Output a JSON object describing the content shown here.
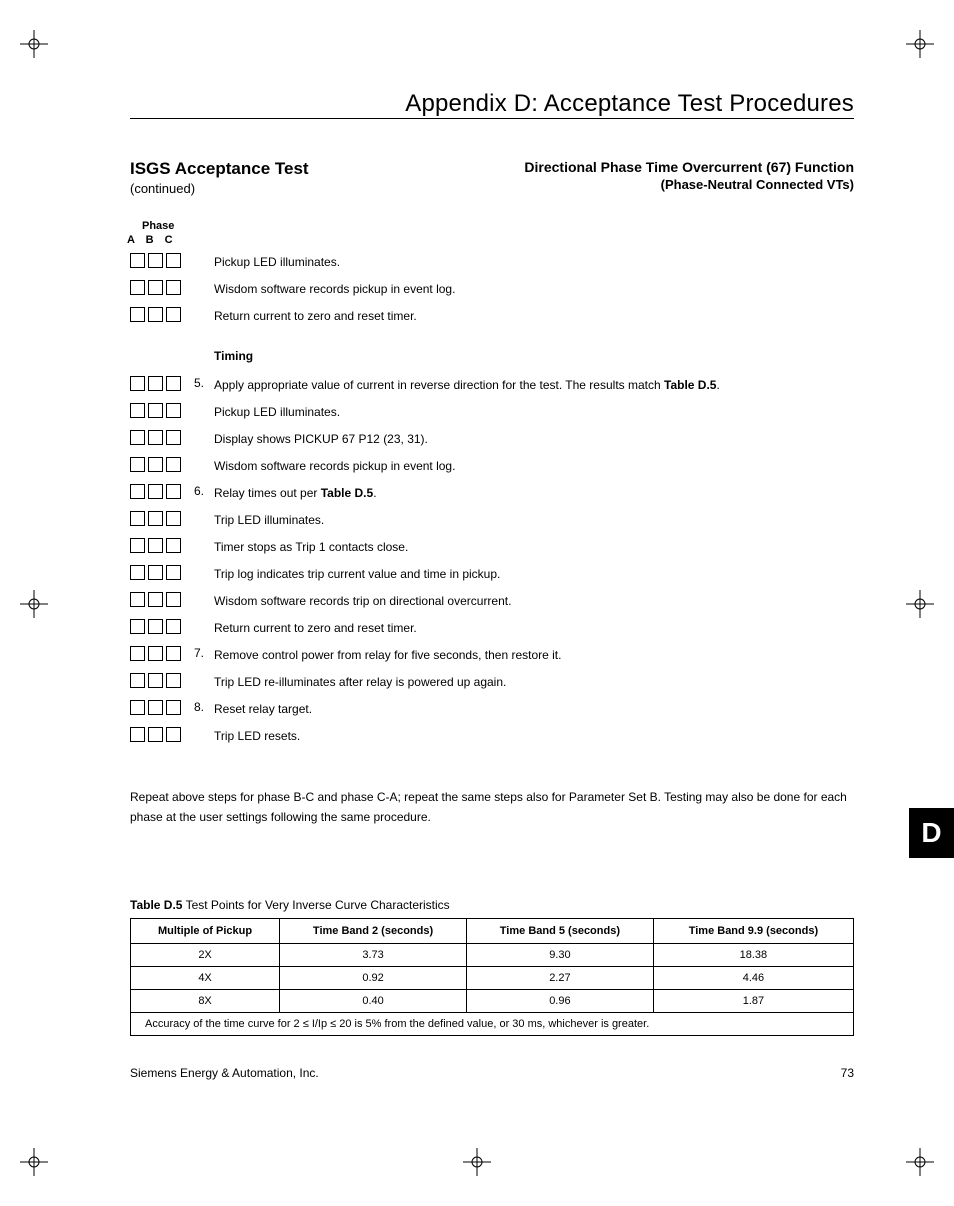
{
  "appendix_title": "Appendix D:  Acceptance Test Procedures",
  "header": {
    "left_title": "ISGS Acceptance Test",
    "left_sub": "(continued)",
    "right_title": "Directional Phase Time Overcurrent (67) Function",
    "right_sub": "(Phase-Neutral Connected VTs)"
  },
  "phase_label": "Phase",
  "phase_abc": "A   B   C",
  "rows1": [
    {
      "num": "",
      "text": "Pickup LED illuminates."
    },
    {
      "num": "",
      "text": "Wisdom software records pickup in event log."
    },
    {
      "num": "",
      "text": "Return current to zero and reset timer."
    }
  ],
  "timing_hdr": "Timing",
  "rows2": [
    {
      "num": "5.",
      "pre": "Apply appropriate value of current in reverse direction for the test. The results match ",
      "bold": "Table D.5",
      "post": "."
    },
    {
      "num": "",
      "text": "Pickup LED illuminates."
    },
    {
      "num": "",
      "text": "Display shows PICKUP 67 P12 (23, 31)."
    },
    {
      "num": "",
      "text": "Wisdom software records pickup in event log."
    },
    {
      "num": "6.",
      "pre": "Relay times out per ",
      "bold": "Table D.5",
      "post": "."
    },
    {
      "num": "",
      "text": "Trip LED illuminates."
    },
    {
      "num": "",
      "text": "Timer stops as Trip 1 contacts close."
    },
    {
      "num": "",
      "text": "Trip log indicates trip current value and time in pickup."
    },
    {
      "num": "",
      "text": "Wisdom software records trip on directional overcurrent."
    },
    {
      "num": "",
      "text": "Return current to zero and reset timer."
    },
    {
      "num": "7.",
      "text": "Remove control power from relay for five seconds, then restore it."
    },
    {
      "num": "",
      "text": "Trip LED re-illuminates after relay is powered up again."
    },
    {
      "num": "8.",
      "text": "Reset relay target."
    },
    {
      "num": "",
      "text": "Trip LED resets."
    }
  ],
  "repeat_note": "Repeat above steps for phase B-C and phase C-A; repeat the same steps also for Parameter Set B. Testing may also be done for each phase at the user settings following the same procedure.",
  "table_caption_bold": "Table D.5",
  "table_caption_rest": " Test Points for Very Inverse Curve Characteristics",
  "chart_data": {
    "type": "table",
    "headers": [
      "Multiple of Pickup",
      "Time Band 2 (seconds)",
      "Time Band 5 (seconds)",
      "Time Band 9.9 (seconds)"
    ],
    "rows": [
      [
        "2X",
        "3.73",
        "9.30",
        "18.38"
      ],
      [
        "4X",
        "0.92",
        "2.27",
        "4.46"
      ],
      [
        "8X",
        "0.40",
        "0.96",
        "1.87"
      ]
    ],
    "note": "Accuracy of the time curve for 2 ≤ I/Ip ≤ 20 is 5% from the defined value, or 30 ms, whichever is greater."
  },
  "footer_left": "Siemens Energy & Automation, Inc.",
  "footer_right": "73",
  "side_tab": "D"
}
